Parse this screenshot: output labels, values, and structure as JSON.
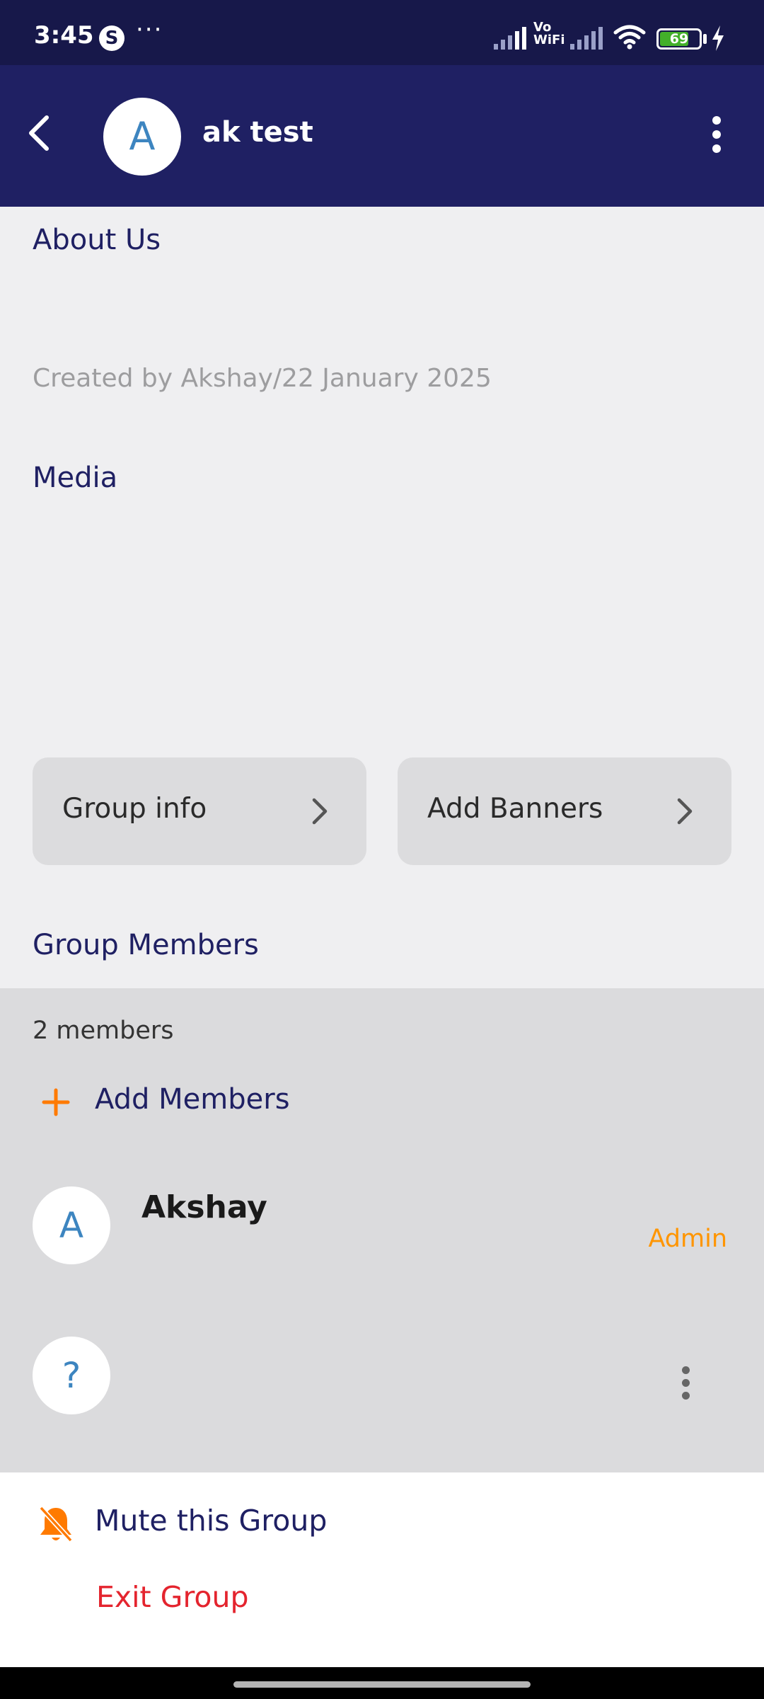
{
  "status_bar": {
    "time": "3:45",
    "skype_badge": "S",
    "more_dots": "···",
    "vowifi_top": "Vo",
    "vowifi_bottom": "WiFi",
    "battery_level": "69",
    "battery_color": "#43b02a"
  },
  "header": {
    "avatar_initial": "A",
    "title": "ak test",
    "background": "#1f2063"
  },
  "about": {
    "title": "About Us",
    "created_by": "Created by Akshay/22 January 2025"
  },
  "media": {
    "title": "Media"
  },
  "actions": {
    "group_info": "Group info",
    "add_banners": "Add Banners"
  },
  "members": {
    "title": "Group Members",
    "count": "2 members",
    "add_label": "Add Members",
    "list": [
      {
        "initial": "A",
        "name": "Akshay",
        "role": "Admin"
      },
      {
        "initial": "?",
        "name": "",
        "role": ""
      }
    ]
  },
  "bottom": {
    "mute_label": "Mute this Group",
    "exit_label": "Exit Group"
  },
  "colors": {
    "accent_orange": "#ff9500",
    "danger_red": "#e4242e",
    "avatar_letter": "#3d85c0"
  }
}
